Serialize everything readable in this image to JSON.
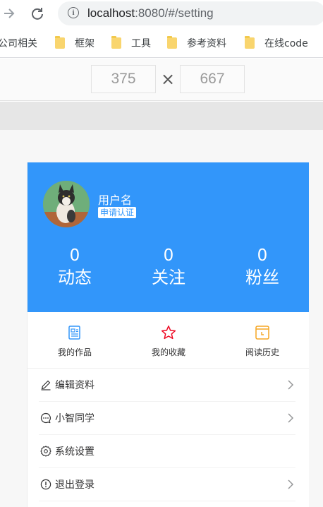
{
  "browser": {
    "url_host": "localhost",
    "url_rest": ":8080/#/setting",
    "bookmarks": [
      {
        "label": "公司相关",
        "icon": "folder-icon"
      },
      {
        "label": "框架",
        "icon": "folder-icon"
      },
      {
        "label": "工具",
        "icon": "folder-icon"
      },
      {
        "label": "参考资料",
        "icon": "folder-icon"
      },
      {
        "label": "在线code",
        "icon": "folder-icon"
      }
    ]
  },
  "device_toolbar": {
    "width": "375",
    "separator": "×",
    "height": "667"
  },
  "colors": {
    "brand_blue": "#3296fa",
    "star_red": "#ee0a24",
    "history_orange": "#f5a623"
  },
  "profile": {
    "username": "用户名",
    "badge": "申请认证",
    "stats": [
      {
        "value": "0",
        "label": "动态"
      },
      {
        "value": "0",
        "label": "关注"
      },
      {
        "value": "0",
        "label": "粉丝"
      }
    ]
  },
  "grid": [
    {
      "label": "我的作品",
      "icon": "works-icon"
    },
    {
      "label": "我的收藏",
      "icon": "star-icon"
    },
    {
      "label": "阅读历史",
      "icon": "history-icon"
    }
  ],
  "menu": [
    {
      "label": "编辑资料",
      "icon": "edit-icon",
      "arrow": true
    },
    {
      "label": "小智同学",
      "icon": "chat-icon",
      "arrow": true
    },
    {
      "label": "系统设置",
      "icon": "settings-icon",
      "arrow": false
    },
    {
      "label": "退出登录",
      "icon": "logout-icon",
      "arrow": true
    }
  ]
}
